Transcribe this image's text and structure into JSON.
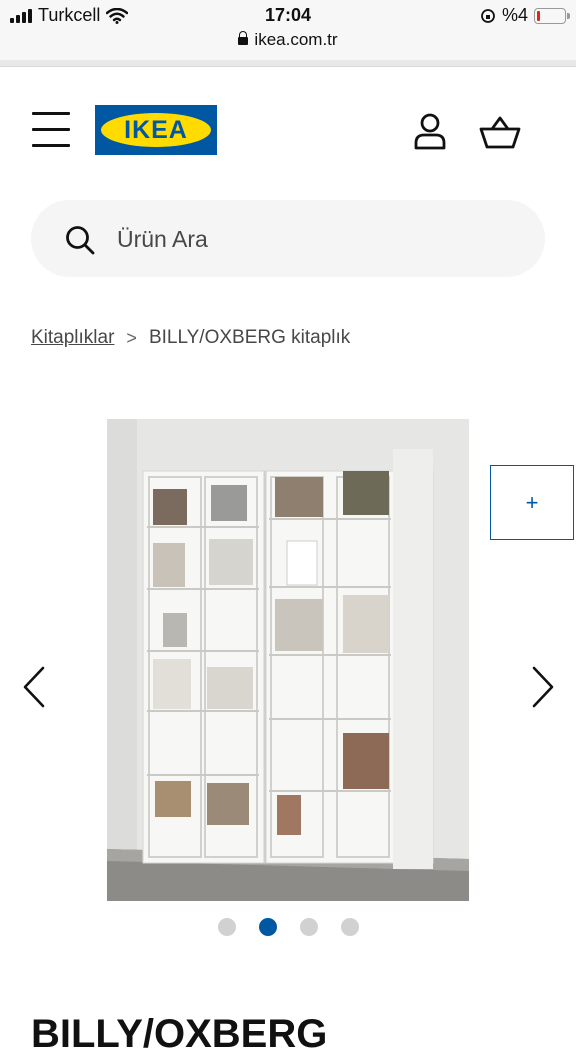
{
  "status_bar": {
    "carrier": "Turkcell",
    "time": "17:04",
    "battery": "%4",
    "battery_level": 0.04
  },
  "browser": {
    "url": "ikea.com.tr"
  },
  "header": {
    "logo_text": "IKEA",
    "icons": [
      "menu-icon",
      "user-icon",
      "cart-icon"
    ]
  },
  "search": {
    "placeholder": "Ürün Ara"
  },
  "breadcrumb": {
    "parent": "Kitaplıklar",
    "current": "BILLY/OXBERG kitaplık"
  },
  "gallery": {
    "next_thumb_symbol": "+",
    "image_count": 4,
    "active_index": 1
  },
  "product": {
    "title_partial": "BILLY/OXBERG"
  },
  "colors": {
    "brand_blue": "#0058a3",
    "brand_yellow": "#ffdb00",
    "search_bg": "#f5f5f5"
  }
}
